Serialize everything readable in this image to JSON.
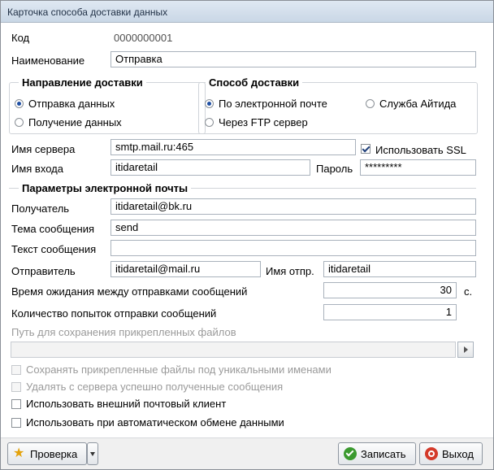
{
  "window": {
    "title": "Карточка способа доставки данных"
  },
  "fields": {
    "code_label": "Код",
    "code_value": "0000000001",
    "name_label": "Наименование",
    "name_value": "Отправка"
  },
  "direction": {
    "legend": "Направление доставки",
    "options": [
      "Отправка данных",
      "Получение данных"
    ],
    "selected": "Отправка данных"
  },
  "method": {
    "legend": "Способ доставки",
    "options": [
      "По электронной почте",
      "Служба Айтида",
      "Через FTP сервер"
    ],
    "selected": "По электронной почте"
  },
  "server": {
    "server_label": "Имя сервера",
    "server_value": "smtp.mail.ru:465",
    "ssl_label": "Использовать SSL",
    "ssl_checked": true,
    "login_label": "Имя входа",
    "login_value": "itidaretail",
    "password_label": "Пароль",
    "password_value": "*********"
  },
  "email": {
    "legend": "Параметры электронной почты",
    "recipient_label": "Получатель",
    "recipient_value": "itidaretail@bk.ru",
    "subject_label": "Тема сообщения",
    "subject_value": "send",
    "body_label": "Текст сообщения",
    "body_value": "",
    "sender_label": "Отправитель",
    "sender_value": "itidaretail@mail.ru",
    "sender_name_label": "Имя отпр.",
    "sender_name_value": "itidaretail",
    "wait_label": "Время ожидания между отправками сообщений",
    "wait_value": "30",
    "wait_unit": "с.",
    "attempts_label": "Количество попыток отправки сообщений",
    "attempts_value": "1",
    "path_label": "Путь для сохранения прикрепленных файлов",
    "path_value": ""
  },
  "options": {
    "unique_names": "Сохранять прикрепленные файлы под уникальными именами",
    "delete_received": "Удалять с сервера успешно полученные сообщения",
    "external_client": "Использовать внешний почтовый клиент",
    "auto_exchange": "Использовать при автоматическом обмене данными"
  },
  "footer": {
    "check_button": "Проверка",
    "save_button": "Записать",
    "exit_button": "Выход"
  }
}
